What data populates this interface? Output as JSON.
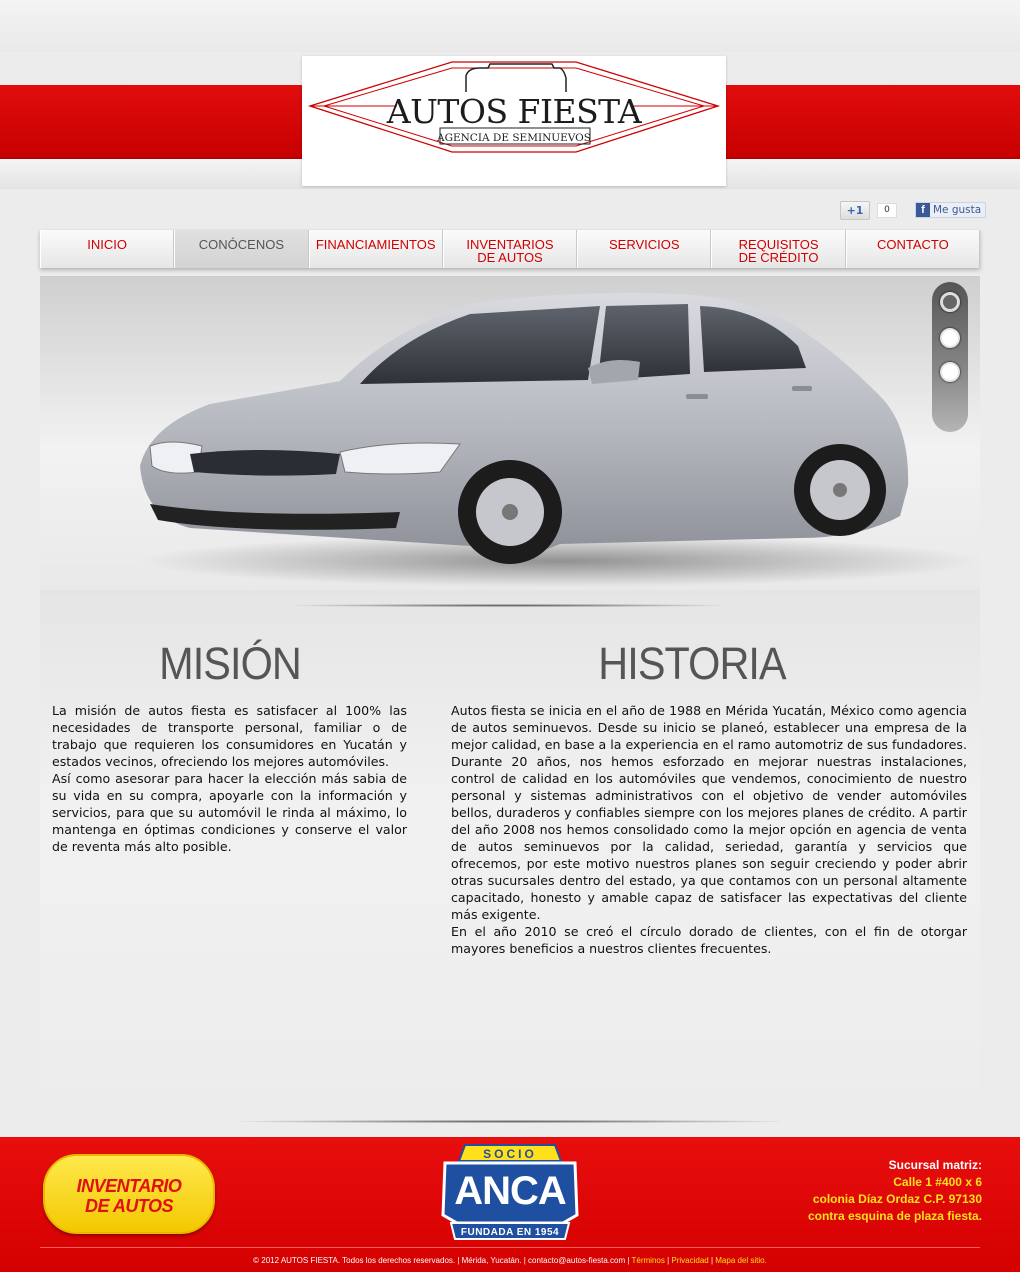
{
  "brand": {
    "title": "AUTOS FIESTA",
    "subtitle": "AGENCIA DE SEMINUEVOS",
    "accent": "#d00000",
    "accent_yellow": "#ffe01a"
  },
  "social": {
    "gplus_label": "+1",
    "gplus_count": "0",
    "fb_icon": "f",
    "fb_label": "Me gusta"
  },
  "nav": {
    "items": [
      {
        "label": "INICIO",
        "active": false
      },
      {
        "label": "CONÓCENOS",
        "active": true
      },
      {
        "label": "FINANCIAMIENTOS",
        "active": false
      },
      {
        "label": "INVENTARIOS\nDE AUTOS",
        "active": false
      },
      {
        "label": "SERVICIOS",
        "active": false
      },
      {
        "label": "REQUISITOS\nDE CRÉDITO",
        "active": false
      },
      {
        "label": "CONTACTO",
        "active": false
      }
    ]
  },
  "slider": {
    "image": "silver-sedan-photo",
    "current_slide": 1,
    "total_slides": 3
  },
  "mision": {
    "title": "MISIÓN",
    "text": "La misión de autos fiesta es satisfacer al 100% las necesidades de transporte personal, familiar o de trabajo que requieren los consumidores en Yucatán y estados vecinos, ofreciendo los mejores automóviles.\nAsí como asesorar para hacer la elección más sabia de su vida en su compra, apoyarle con la información y servicios, para que su automóvil le rinda al máximo, lo mantenga en óptimas condiciones y conserve el valor de reventa más alto posible."
  },
  "historia": {
    "title": "HISTORIA",
    "text": "Autos fiesta se inicia en el año de 1988 en Mérida Yucatán, México  como agencia de autos seminuevos. Desde su inicio se planeó, establecer una empresa de la mejor calidad, en base a la experiencia en el ramo automotriz de sus fundadores.\nDurante 20 años, nos hemos esforzado en mejorar nuestras instalaciones, control de calidad en los automóviles que vendemos, conocimiento de nuestro personal y sistemas administrativos con el objetivo de vender automóviles bellos, duraderos y confiables siempre con los mejores planes de crédito. A partir del año 2008 nos hemos consolidado como la mejor opción en agencia de venta de autos seminuevos por la calidad, seriedad,  garantía y servicios que ofrecemos, por este motivo nuestros planes son seguir creciendo y poder abrir otras sucursales dentro del estado, ya que contamos con un personal altamente capacitado, honesto y amable capaz de satisfacer las expectativas del cliente más exigente.\nEn el año 2010 se creó el círculo dorado de clientes, con el fin de otorgar mayores beneficios a nuestros clientes frecuentes."
  },
  "footer": {
    "inventory_button": "INVENTARIO\nDE AUTOS",
    "anca": {
      "socio": "SOCIO",
      "name": "ANCA",
      "founded": "FUNDADA EN 1954"
    },
    "address": {
      "title": "Sucursal matriz:",
      "line1": "Calle 1 #400 x 6",
      "line2": "colonia Díaz Ordaz  C.P. 97130",
      "line3": "contra esquina de plaza fiesta."
    },
    "copyright": "© 2012 AUTOS FIESTA. Todos los derechos reservados. | Mérida, Yucatán. | contacto@autos-fiesta.com | ",
    "links": [
      "Términos",
      "Privacidad",
      "Mapa del sitio."
    ]
  }
}
